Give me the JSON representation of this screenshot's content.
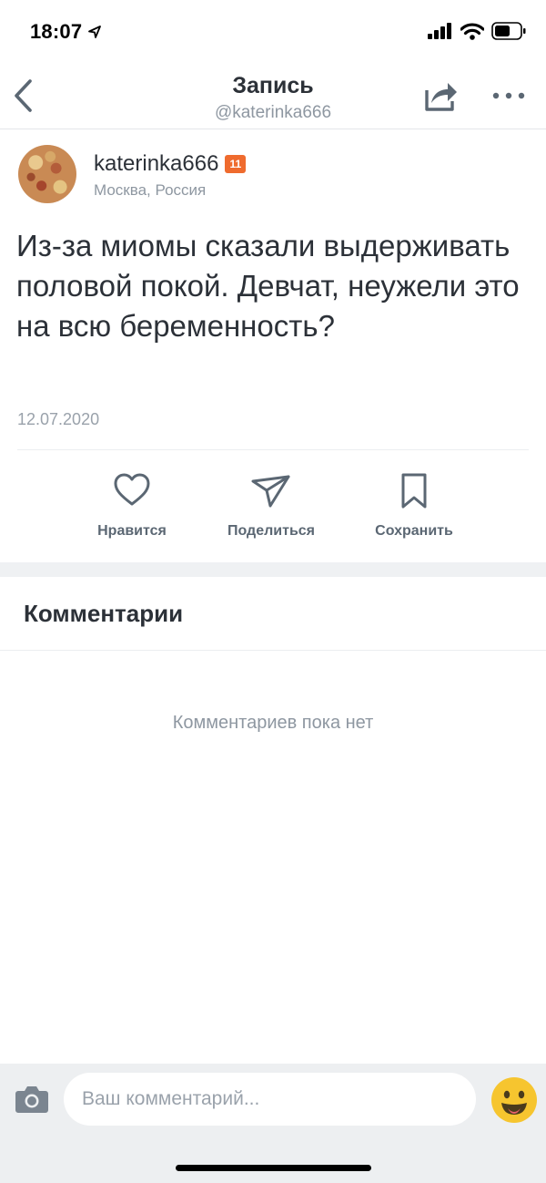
{
  "status_bar": {
    "time": "18:07",
    "icons": [
      "location-arrow-icon",
      "cellular-signal-icon",
      "wifi-icon",
      "battery-icon"
    ]
  },
  "navbar": {
    "title": "Запись",
    "subtitle": "@katerinka666",
    "icons": [
      "chevron-left-icon",
      "share-icon",
      "more-dots-icon"
    ]
  },
  "post": {
    "username": "katerinka666",
    "level": "11",
    "location": "Москва, Россия",
    "text": "Из-за миомы сказали выдерживать половой покой. Девчат, неужели это на всю беременность?",
    "date": "12.07.2020"
  },
  "actions": {
    "like_label": "Нравится",
    "share_label": "Поделиться",
    "save_label": "Сохранить"
  },
  "comments": {
    "title": "Комментарии",
    "empty_text": "Комментариев пока нет"
  },
  "input": {
    "placeholder": "Ваш комментарий..."
  },
  "colors": {
    "text": "#2c3138",
    "muted": "#8e97a1",
    "icon": "#5b6773",
    "badge": "#ef6b2e",
    "bar_bg": "#edeff1",
    "emoji": "#f6c52f"
  }
}
